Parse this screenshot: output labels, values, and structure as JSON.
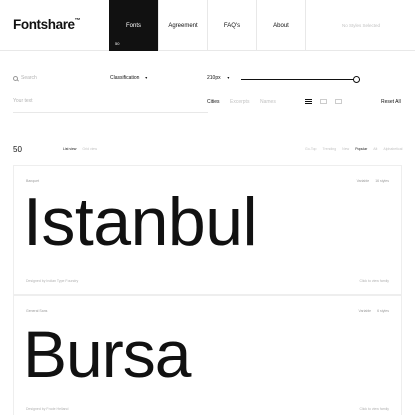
{
  "header": {
    "logo": "Fontshare",
    "logo_mark": "™",
    "nav": [
      {
        "label": "Fonts",
        "count": "50"
      },
      {
        "label": "Agreement"
      },
      {
        "label": "FAQ's"
      },
      {
        "label": "About"
      }
    ],
    "selection_status": "No Styles Selected"
  },
  "filters": {
    "search_placeholder": "Search",
    "classification_label": "Classification",
    "size_value": "210px",
    "size_slider_fraction": 0.97
  },
  "preview": {
    "placeholder": "Your text",
    "presets": [
      "Cities",
      "Excerpts",
      "Names"
    ],
    "reset_label": "Reset All"
  },
  "list": {
    "count": "50",
    "views": [
      "List view",
      "Grid view"
    ],
    "sorts": [
      "Go-Top",
      "Trending",
      "New",
      "Popular",
      "Alt",
      "Alphabetical"
    ]
  },
  "cards": [
    {
      "name": "Banquet",
      "type": "Variable",
      "styles": "16 styles",
      "specimen": "Istanbul",
      "designer": "Designed by Indian Type Foundry",
      "action": "Click to view family"
    },
    {
      "name": "General Sans",
      "type": "Variable",
      "styles": "6 styles",
      "specimen": "Bursa",
      "designer": "Designed by Frode Helland",
      "action": "Click to view family"
    }
  ],
  "colors": {
    "active_nav_bg": "#111111",
    "text": "#111111",
    "muted": "#b3b3b3",
    "border": "#e8e8e8"
  }
}
